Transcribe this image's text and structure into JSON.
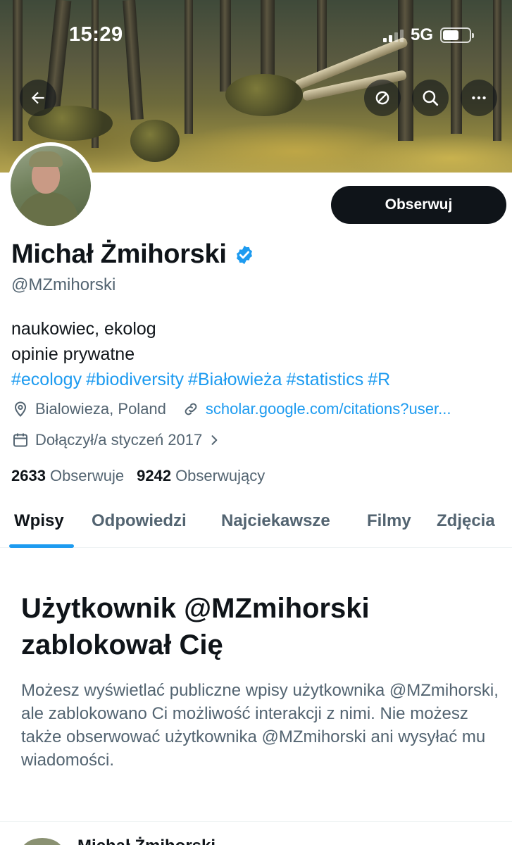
{
  "status_bar": {
    "time": "15:29",
    "network": "5G"
  },
  "banner": {
    "description_icons": [
      "back-arrow-icon",
      "refresh-icon",
      "search-icon",
      "more-icon"
    ]
  },
  "profile": {
    "name": "Michał Żmihorski",
    "handle": "@MZmihorski",
    "verified": true,
    "follow_label": "Obserwuj",
    "bio_lines": [
      "naukowiec, ekolog",
      "opinie prywatne"
    ],
    "hashtags": [
      "#ecology",
      "#biodiversity",
      "#Białowieża",
      "#statistics",
      "#R"
    ],
    "location": "Bialowieza, Poland",
    "website": "scholar.google.com/citations?user...",
    "joined": "Dołączył/a styczeń 2017",
    "following_count": "2633",
    "following_label": "Obserwuje",
    "followers_count": "9242",
    "followers_label": "Obserwujący"
  },
  "tabs": [
    "Wpisy",
    "Odpowiedzi",
    "Najciekawsze",
    "Filmy",
    "Zdjęcia"
  ],
  "blocked": {
    "title": "Użytkownik @MZmihorski zablokował Cię",
    "text": "Możesz wyświetlać publiczne wpisy użytkownika @MZmihorski, ale zablokowano Ci możliwość interakcji z nimi. Nie możesz także obserwować użytkownika @MZmihorski ani wysyłać mu wiadomości."
  },
  "peek": {
    "text": "Michał Żmihorski"
  },
  "colors": {
    "accent": "#1d9bf0",
    "text": "#0f1419",
    "secondary": "#536471",
    "button": "#0f1419"
  }
}
